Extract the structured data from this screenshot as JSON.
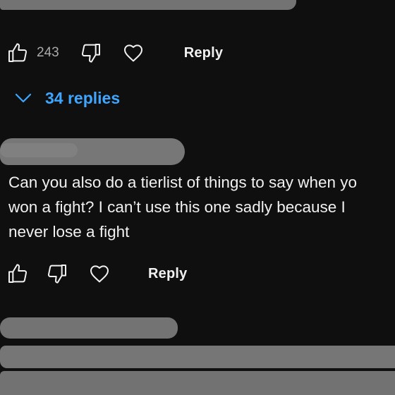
{
  "first_comment": {
    "like_count": "243",
    "reply_label": "Reply",
    "replies_toggle_label": "34 replies"
  },
  "second_comment": {
    "text": "Can you also do a tierlist of things to say when yo\nwon a fight? I can’t use this one sadly because I\nnever lose a fight",
    "reply_label": "Reply"
  },
  "icons": {
    "like": "thumbs-up-icon",
    "dislike": "thumbs-down-icon",
    "heart": "heart-icon",
    "expand": "chevron-down-icon"
  },
  "colors": {
    "background": "#0f0f0f",
    "text": "#f1f1f1",
    "muted_text": "#aaaaaa",
    "link_blue": "#3ea6ff",
    "redaction_gray": "#737373"
  }
}
